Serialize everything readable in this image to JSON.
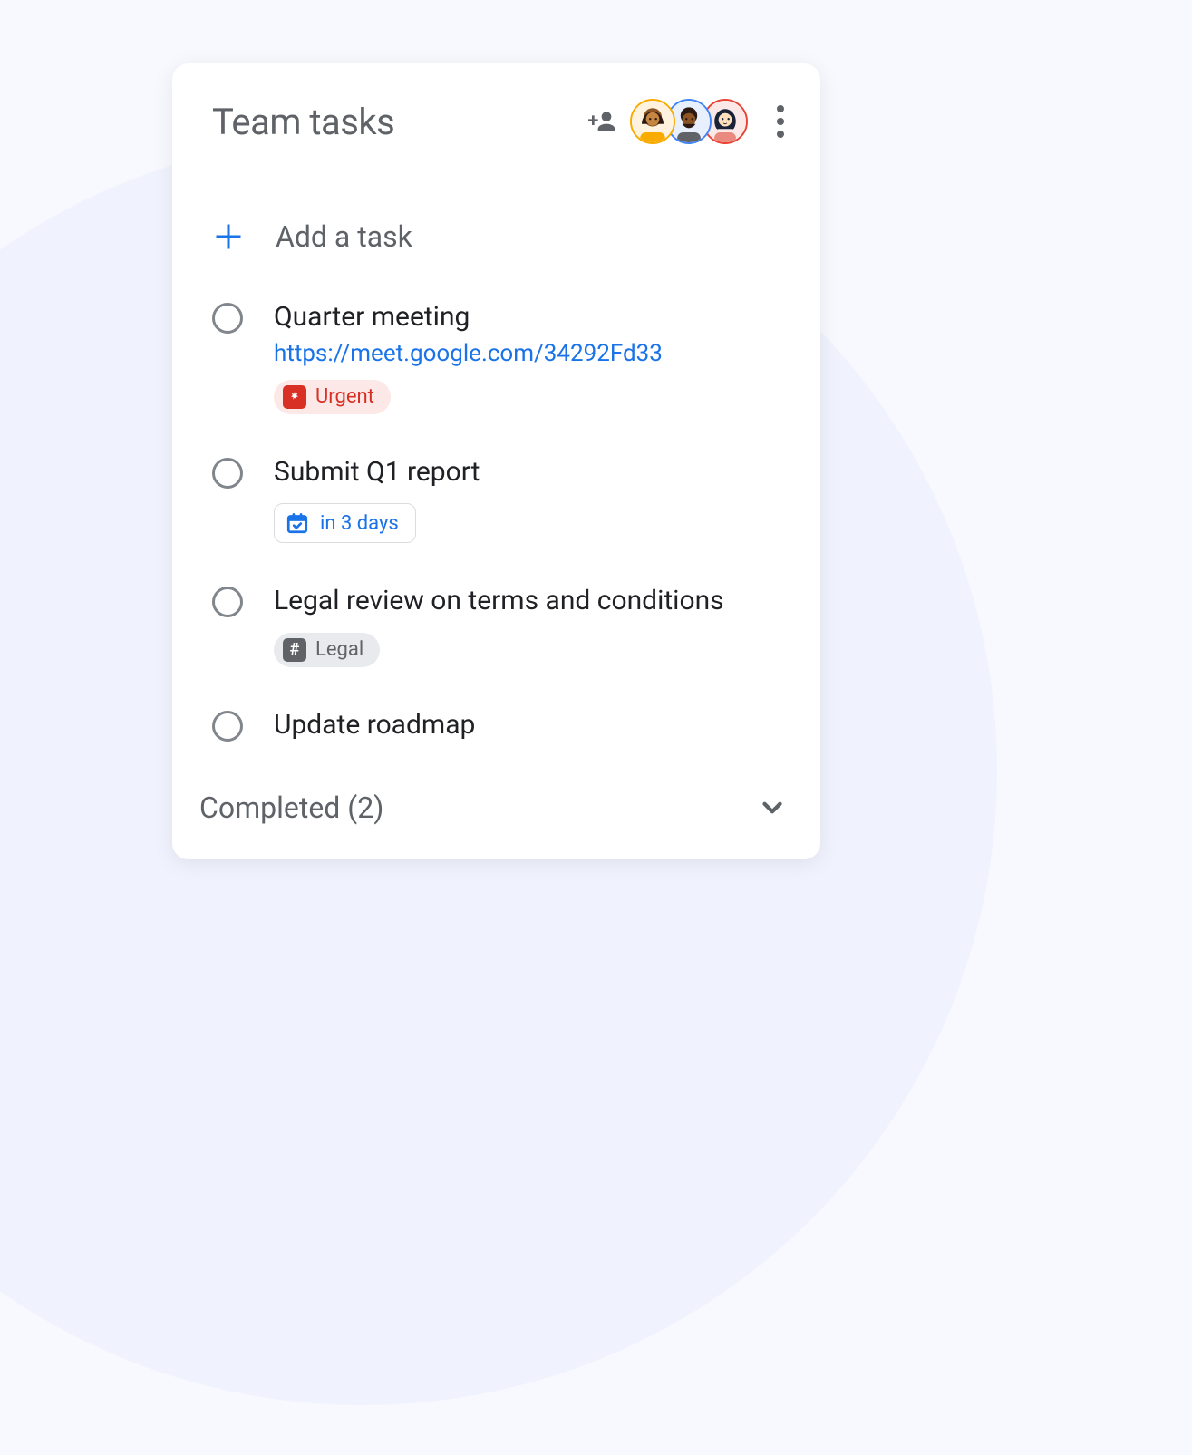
{
  "header": {
    "title": "Team tasks",
    "avatars": [
      {
        "name": "member-1",
        "ring": "#f9ab00"
      },
      {
        "name": "member-2",
        "ring": "#4285f4"
      },
      {
        "name": "member-3",
        "ring": "#ea4335"
      }
    ]
  },
  "add_task": {
    "label": "Add a task"
  },
  "tasks": [
    {
      "title": "Quarter meeting",
      "link": "https://meet.google.com/34292Fd33",
      "tag": {
        "type": "urgent",
        "label": "Urgent"
      }
    },
    {
      "title": "Submit Q1 report",
      "due": {
        "label": "in 3 days"
      }
    },
    {
      "title": "Legal review on terms and conditions",
      "tag": {
        "type": "legal",
        "label": "Legal"
      }
    },
    {
      "title": "Update roadmap"
    }
  ],
  "completed": {
    "label": "Completed (2)",
    "count": 2
  }
}
